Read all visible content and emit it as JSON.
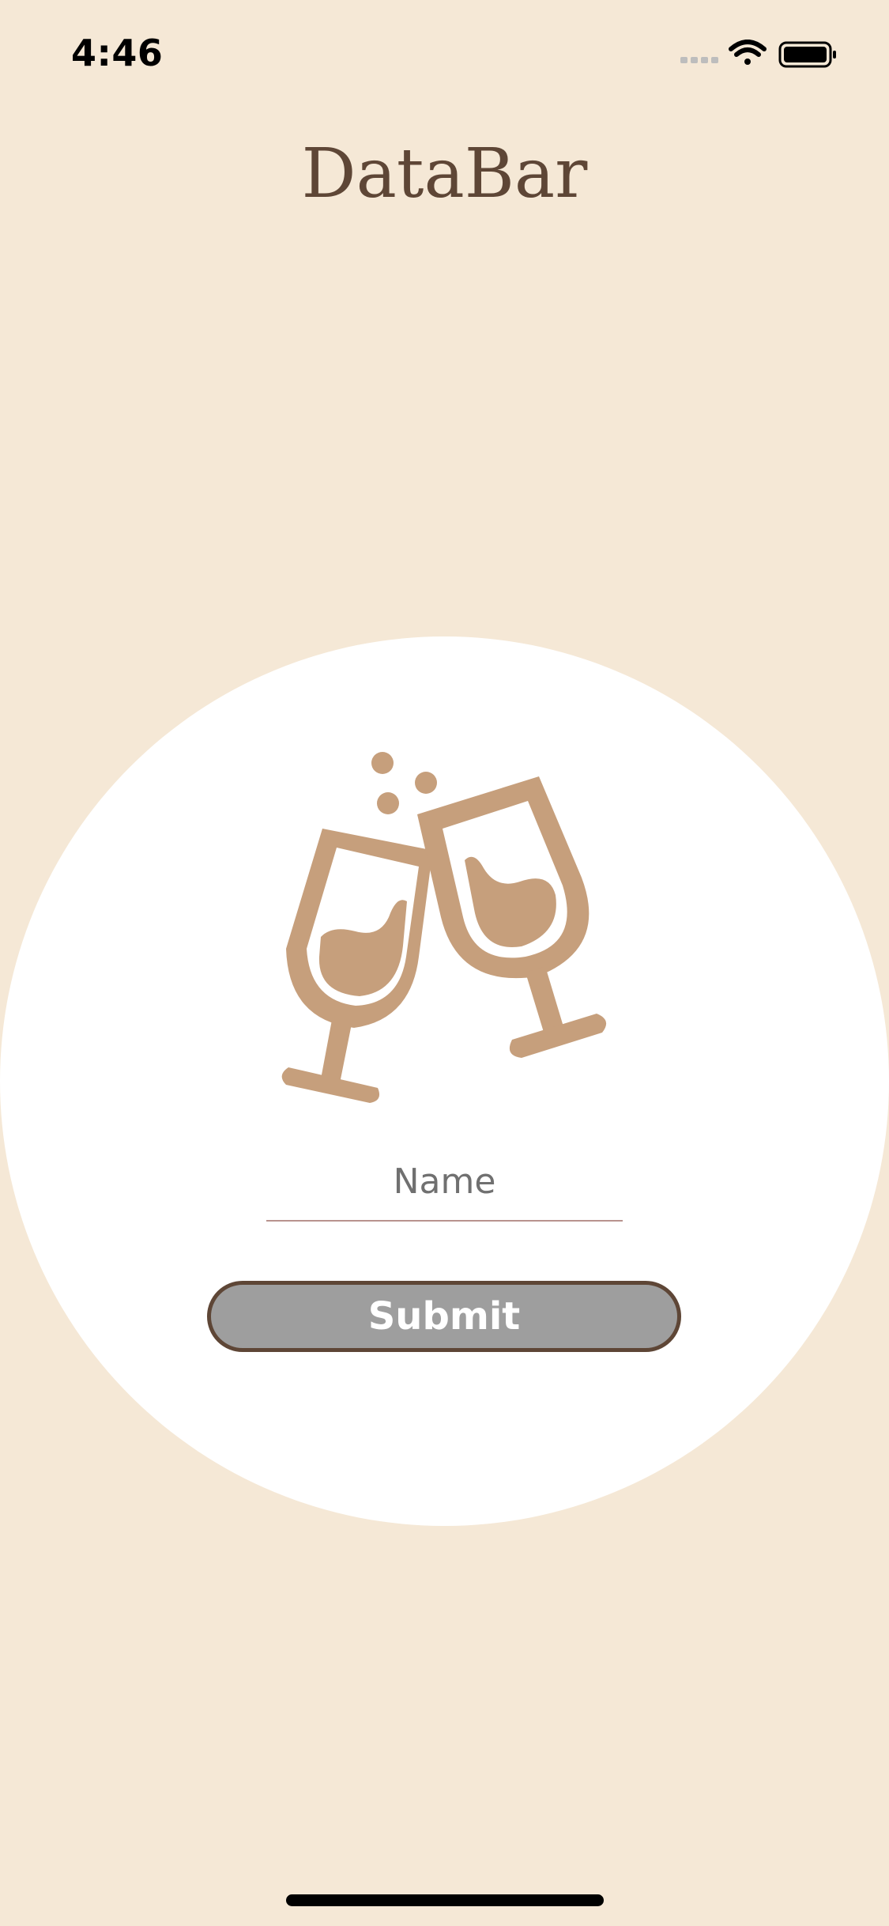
{
  "status_bar": {
    "time": "4:46",
    "icons": [
      "signal-icon",
      "wifi-icon",
      "battery-icon"
    ]
  },
  "app": {
    "title": "DataBar"
  },
  "logo": {
    "icon": "toasting-glasses-icon",
    "color": "#C69F7C"
  },
  "form": {
    "name_placeholder": "Name",
    "name_value": "",
    "submit_label": "Submit"
  },
  "colors": {
    "background": "#F5E8D6",
    "title": "#5E4636",
    "card": "#FFFFFF",
    "button_fill": "#9E9E9E",
    "button_border": "#5E4636",
    "underline": "#B8938E"
  }
}
